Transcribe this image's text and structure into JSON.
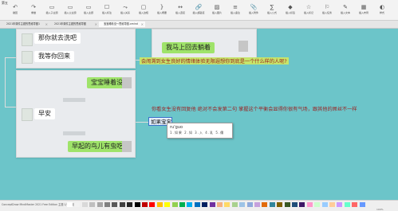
{
  "window": {
    "title_fragment": "第五"
  },
  "toolbar": {
    "items": [
      {
        "icon": "undo-icon",
        "glyph": "↶",
        "label": "撤回"
      },
      {
        "icon": "redo-icon",
        "glyph": "↷",
        "label": "重做"
      },
      {
        "icon": "topic-icon",
        "glyph": "▭",
        "label": "插入子主题"
      },
      {
        "icon": "topic-icon",
        "glyph": "▭",
        "label": "插入父主题"
      },
      {
        "icon": "topic-icon",
        "glyph": "▭",
        "label": "插入主题"
      },
      {
        "icon": "callout-icon",
        "glyph": "☐",
        "label": "插入标注"
      },
      {
        "icon": "relation-icon",
        "glyph": "⤳",
        "label": "插入关系"
      },
      {
        "icon": "boundary-icon",
        "glyph": "▢",
        "label": "插入边框"
      },
      {
        "icon": "summary-icon",
        "glyph": "}",
        "label": "插入概要"
      },
      {
        "icon": "connector-icon",
        "glyph": "↔",
        "label": "插入连接"
      },
      {
        "icon": "link-icon",
        "glyph": "🔗",
        "label": "插入超链接"
      },
      {
        "icon": "image-icon",
        "glyph": "▨",
        "label": "插入图片"
      },
      {
        "icon": "note-icon",
        "glyph": "≡",
        "label": "插入备注"
      },
      {
        "icon": "attach-icon",
        "glyph": "📎",
        "label": "插入附件"
      },
      {
        "icon": "formula-icon",
        "glyph": "∑",
        "label": "插入公式"
      },
      {
        "icon": "label-icon",
        "glyph": "◆",
        "label": "插入标签"
      },
      {
        "icon": "mark-icon",
        "glyph": "☆",
        "label": "插入标记"
      },
      {
        "icon": "tag-icon",
        "glyph": "⚐",
        "label": "插入任务"
      },
      {
        "icon": "format-icon",
        "glyph": "✎",
        "label": "插入文本"
      },
      {
        "icon": "layout-icon",
        "glyph": "▦",
        "label": "插入布局"
      },
      {
        "icon": "style-icon",
        "glyph": "◐",
        "label": "样式"
      }
    ]
  },
  "tabs": [
    {
      "label": "2021年课件主题的思维导图1",
      "active": false
    },
    {
      "label": "2021年课件主题的思维导图",
      "active": false
    },
    {
      "label": "宝宝睡着没～思维导图.xmind",
      "active": true
    }
  ],
  "chat1": {
    "left1": "那你就去洗吧",
    "left2": "我等你回来",
    "right1": "我马上回去躺着"
  },
  "chat2": {
    "right1": "宝宝睡着没",
    "left1": "早安",
    "right2": "早起的鸟儿有虫吃"
  },
  "topics": {
    "t1": "会闹溯到女生良好的情绪体验无限遐想你到底是一个什么样的人呢?",
    "t2": "你看女生没有回复他   绝对不会发第二句   掌握这个平衡会显得你很有气场，跟其他的屌丝不一样"
  },
  "editing": {
    "text": "如果宝宝"
  },
  "ime": {
    "composition": "ru'guo",
    "candidates": "1.如果 2.如 3.入 4.乳 5.儒"
  },
  "status": {
    "text": "ConceptDraw MindMaster 2021 Free Edition  主题 1/1  自动保存"
  },
  "palette": [
    "#ffffff",
    "#f2f2f2",
    "#d9d9d9",
    "#bfbfbf",
    "#a6a6a6",
    "#808080",
    "#595959",
    "#404040",
    "#262626",
    "#000000",
    "#c00000",
    "#ff0000",
    "#ffc000",
    "#ffff00",
    "#92d050",
    "#00b050",
    "#00b0f0",
    "#0070c0",
    "#002060",
    "#7030a0",
    "#f4b183",
    "#ffd966",
    "#a9d18e",
    "#9dc3e6",
    "#8faadc",
    "#c5a0dd",
    "#e26b0a",
    "#31859c",
    "#7f6000",
    "#385723",
    "#1f4e79",
    "#3d1866",
    "#ff99cc",
    "#ccffcc",
    "#99ccff",
    "#ffcc99",
    "#cc99ff",
    "#66ffcc",
    "#ff6666",
    "#6699ff"
  ],
  "zoom": "100%"
}
